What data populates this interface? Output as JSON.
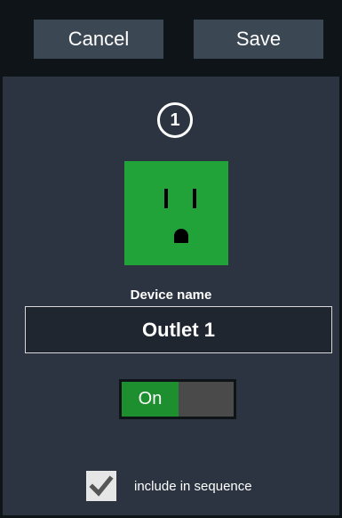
{
  "toolbar": {
    "cancel_label": "Cancel",
    "save_label": "Save"
  },
  "device": {
    "number": "1",
    "icon": "power-outlet-icon",
    "tile_color": "#22a33a",
    "name_label": "Device name",
    "name_value": "Outlet 1"
  },
  "power_toggle": {
    "on_label": "On",
    "state": "on",
    "on_color": "#1e8f2f"
  },
  "sequence": {
    "checked": true,
    "label": "include in sequence"
  }
}
